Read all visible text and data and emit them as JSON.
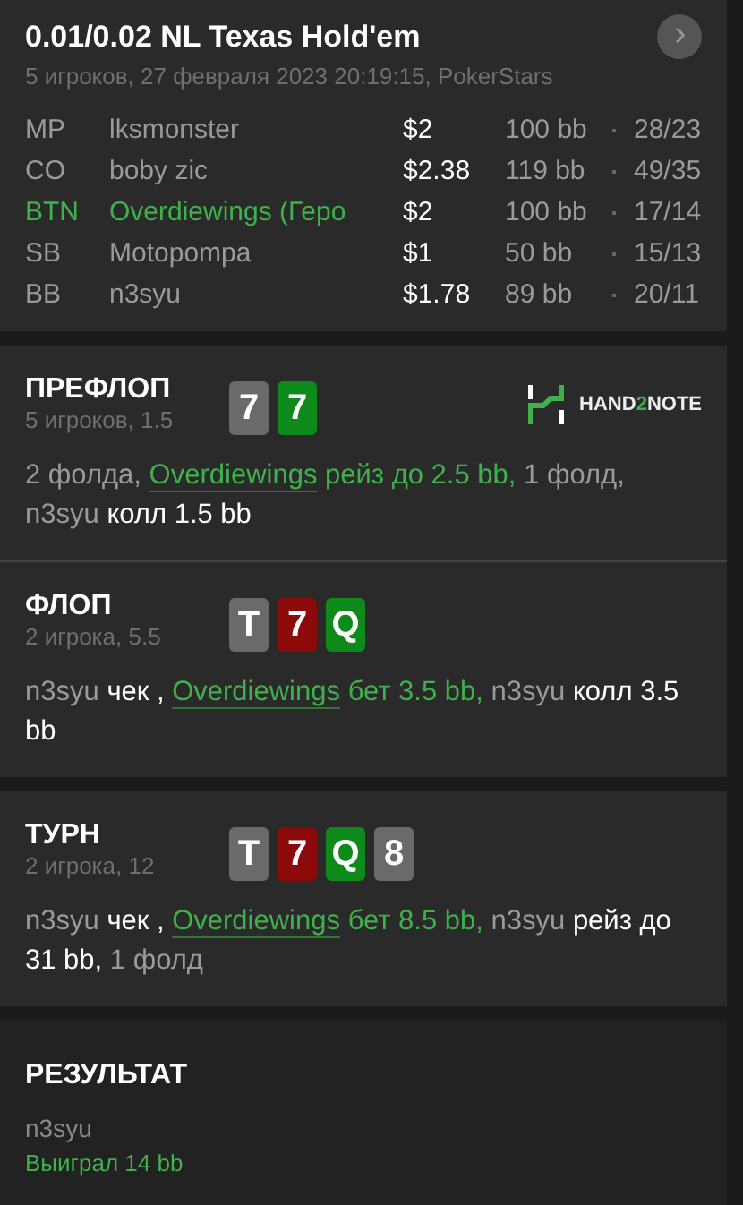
{
  "header": {
    "title": "0.01/0.02 NL Texas Hold'em",
    "subtitle": "5 игроков, 27 февраля 2023 20:19:15, PokerStars",
    "next_button": "›"
  },
  "players": [
    {
      "position": "MP",
      "name": "lksmonster",
      "stack": "$2",
      "bb": "100 bb",
      "stats": "28/23",
      "hero": false
    },
    {
      "position": "CO",
      "name": "boby zic",
      "stack": "$2.38",
      "bb": "119 bb",
      "stats": "49/35",
      "hero": false
    },
    {
      "position": "BTN",
      "name": "Overdiewings (Геро",
      "stack": "$2",
      "bb": "100 bb",
      "stats": "17/14",
      "hero": true
    },
    {
      "position": "SB",
      "name": "Motopompa",
      "stack": "$1",
      "bb": "50 bb",
      "stats": "15/13",
      "hero": false
    },
    {
      "position": "BB",
      "name": "n3syu",
      "stack": "$1.78",
      "bb": "89 bb",
      "stats": "20/11",
      "hero": false
    }
  ],
  "streets": [
    {
      "title": "ПРЕФЛОП",
      "info": "5 игроков, 1.5",
      "logo": true,
      "cards": [
        {
          "rank": "7",
          "color": "#6a6a6a"
        },
        {
          "rank": "7",
          "color": "#0e8a1a"
        }
      ],
      "actions": [
        {
          "kind": "muted",
          "text": "2 фолда,"
        },
        {
          "kind": "hero",
          "text": "Overdiewings"
        },
        {
          "kind": "hero_action",
          "text": "рейз до 2.5 bb,"
        },
        {
          "kind": "muted",
          "text": "1 фолд,"
        },
        {
          "kind": "player",
          "text": "n3syu"
        },
        {
          "kind": "action",
          "text": "колл 1.5 bb"
        }
      ]
    },
    {
      "title": "ФЛОП",
      "info": "2 игрока, 5.5",
      "logo": false,
      "cards": [
        {
          "rank": "T",
          "color": "#6a6a6a"
        },
        {
          "rank": "7",
          "color": "#8c0a0a"
        },
        {
          "rank": "Q",
          "color": "#0e8a1a"
        }
      ],
      "actions": [
        {
          "kind": "player",
          "text": "n3syu"
        },
        {
          "kind": "action",
          "text": "чек ,"
        },
        {
          "kind": "hero",
          "text": "Overdiewings"
        },
        {
          "kind": "hero_action",
          "text": "бет 3.5 bb,"
        },
        {
          "kind": "player",
          "text": "n3syu"
        },
        {
          "kind": "action",
          "text": "колл 3.5 bb"
        }
      ]
    },
    {
      "title": "ТУРН",
      "info": "2 игрока, 12",
      "logo": false,
      "cards": [
        {
          "rank": "T",
          "color": "#6a6a6a"
        },
        {
          "rank": "7",
          "color": "#8c0a0a"
        },
        {
          "rank": "Q",
          "color": "#0e8a1a"
        },
        {
          "rank": "8",
          "color": "#6a6a6a"
        }
      ],
      "actions": [
        {
          "kind": "player",
          "text": "n3syu"
        },
        {
          "kind": "action",
          "text": "чек ,"
        },
        {
          "kind": "hero",
          "text": "Overdiewings"
        },
        {
          "kind": "hero_action",
          "text": "бет 8.5 bb,"
        },
        {
          "kind": "player",
          "text": "n3syu"
        },
        {
          "kind": "action",
          "text": "рейз до 31 bb,"
        },
        {
          "kind": "muted",
          "text": "1 фолд"
        }
      ]
    }
  ],
  "logo_text": [
    {
      "text": "HAND",
      "accent": false
    },
    {
      "text": "2",
      "accent": true
    },
    {
      "text": "NOTE",
      "accent": false
    }
  ],
  "result": {
    "title": "РЕЗУЛЬТАТ",
    "player": "n3syu",
    "outcome": "Выиграл 14 bb"
  }
}
